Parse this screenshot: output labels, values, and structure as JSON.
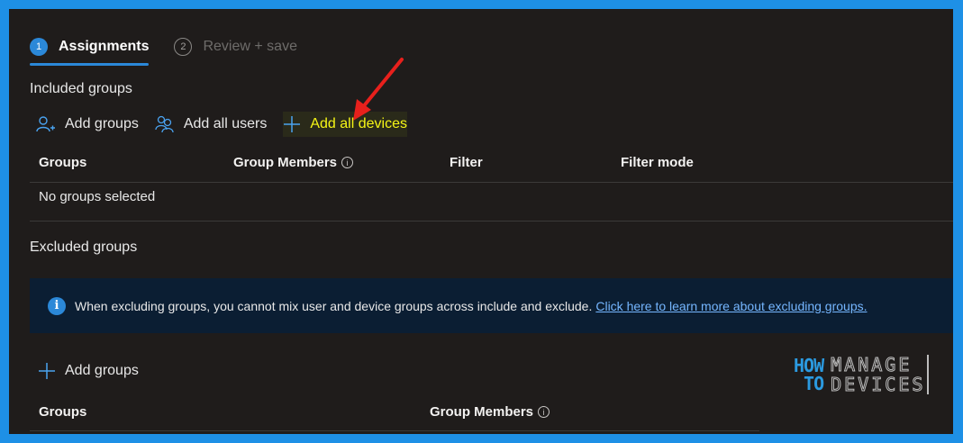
{
  "tabs": [
    {
      "num": "1",
      "label": "Assignments"
    },
    {
      "num": "2",
      "label": "Review + save"
    }
  ],
  "included": {
    "title": "Included groups",
    "actions": {
      "add_groups": "Add groups",
      "add_all_users": "Add all users",
      "add_all_devices": "Add all devices"
    },
    "columns": {
      "groups": "Groups",
      "group_members": "Group Members",
      "filter": "Filter",
      "filter_mode": "Filter mode"
    },
    "empty_text": "No groups selected"
  },
  "excluded": {
    "title": "Excluded groups",
    "banner_text": "When excluding groups, you cannot mix user and device groups across include and exclude.",
    "banner_link": "Click here to learn more about excluding groups.",
    "add_groups": "Add groups",
    "columns": {
      "groups": "Groups",
      "group_members": "Group Members"
    }
  },
  "watermark": {
    "how": "HOW",
    "to": "TO",
    "manage": "MANAGE",
    "devices": "DEVICES"
  },
  "colors": {
    "accent": "#2b88d8",
    "highlight_text": "#f5f516",
    "annotation_arrow": "#e8201c",
    "frame": "#1e90e6"
  },
  "icons": {
    "add_groups": "add-person-icon",
    "add_all_users": "people-icon",
    "add_all_devices": "plus-icon",
    "info": "info-icon"
  }
}
